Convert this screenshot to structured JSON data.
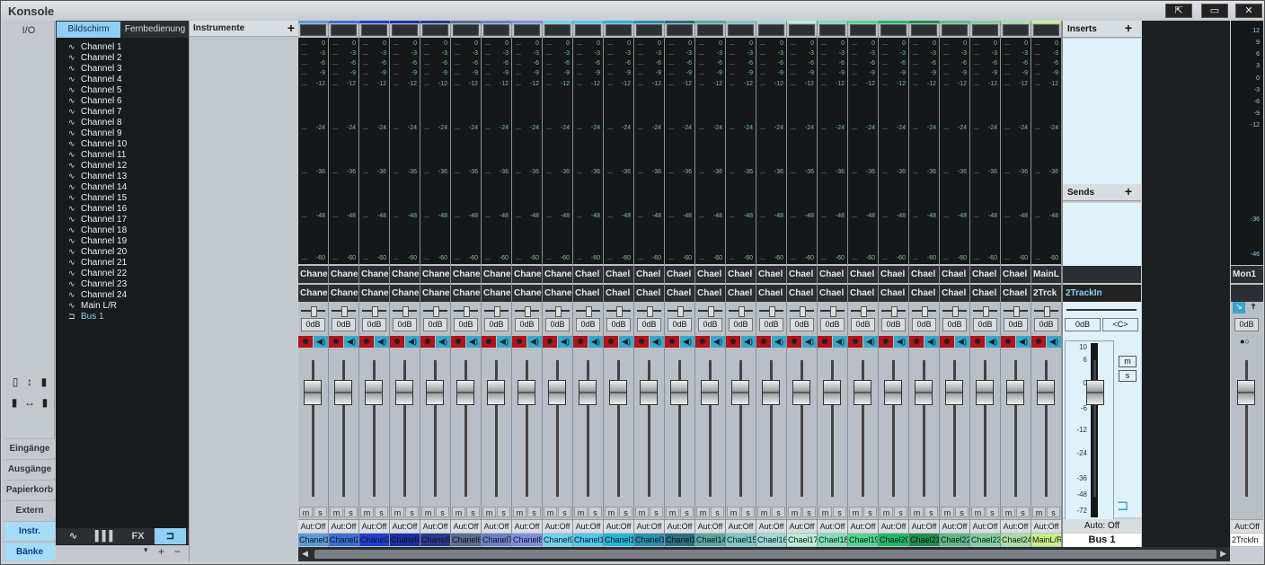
{
  "window": {
    "title": "Konsole"
  },
  "left_nav": {
    "io": "I/O",
    "items": [
      "Eingänge",
      "Ausgänge",
      "Papierkorb",
      "Extern",
      "Instr.",
      "Bänke"
    ]
  },
  "browser": {
    "tab_display": "Bildschirm",
    "tab_remote": "Fernbedienung",
    "items": [
      "Channel 1",
      "Channel 2",
      "Channel 3",
      "Channel 4",
      "Channel 5",
      "Channel 6",
      "Channel 7",
      "Channel 8",
      "Channel 9",
      "Channel 10",
      "Channel 11",
      "Channel 12",
      "Channel 13",
      "Channel 14",
      "Channel 15",
      "Channel 16",
      "Channel 17",
      "Channel 18",
      "Channel 19",
      "Channel 20",
      "Channel 21",
      "Channel 22",
      "Channel 23",
      "Channel 24",
      "Main L/R",
      "Bus 1"
    ],
    "bottom_tabs": [
      "FX"
    ],
    "footer": {
      "add": "+",
      "remove": "−"
    }
  },
  "instruments": {
    "title": "Instrumente",
    "add": "+"
  },
  "meter_scale": [
    "0",
    "-3",
    "-6",
    "-9",
    "-12",
    "-24",
    "-36",
    "-48",
    "-60"
  ],
  "channels": [
    {
      "name1": "Chane",
      "name2": "Chane",
      "label": "Chanel1",
      "color": "#5b9bd5"
    },
    {
      "name1": "Chane",
      "name2": "Chane",
      "label": "Chanel2",
      "color": "#3b6fd6"
    },
    {
      "name1": "Chane",
      "name2": "Chane",
      "label": "Chanel3",
      "color": "#1f3fcf"
    },
    {
      "name1": "Chane",
      "name2": "Chane",
      "label": "Chanel4",
      "color": "#1a2fa6"
    },
    {
      "name1": "Chane",
      "name2": "Chane",
      "label": "Chanel5",
      "color": "#283a8f"
    },
    {
      "name1": "Chane",
      "name2": "Chane",
      "label": "Chanel6",
      "color": "#5a6f8f"
    },
    {
      "name1": "Chane",
      "name2": "Chane",
      "label": "Chanel7",
      "color": "#6a7fc8"
    },
    {
      "name1": "Chane",
      "name2": "Chane",
      "label": "Chanel8",
      "color": "#7f8fe0"
    },
    {
      "name1": "Chane",
      "name2": "Chane",
      "label": "Chanel9",
      "color": "#6fd3f0"
    },
    {
      "name1": "Chael",
      "name2": "Chael",
      "label": "Chanel10",
      "color": "#4fc8ec"
    },
    {
      "name1": "Chael",
      "name2": "Chael",
      "label": "Chanel11",
      "color": "#24b6d8"
    },
    {
      "name1": "Chael",
      "name2": "Chael",
      "label": "Chanel12",
      "color": "#2a8fb0"
    },
    {
      "name1": "Chael",
      "name2": "Chael",
      "label": "Chanel13",
      "color": "#2a6f80"
    },
    {
      "name1": "Chael",
      "name2": "Chael",
      "label": "Chael14",
      "color": "#5aa8a0"
    },
    {
      "name1": "Chael",
      "name2": "Chael",
      "label": "Chael15",
      "color": "#7cc6c8"
    },
    {
      "name1": "Chael",
      "name2": "Chael",
      "label": "Chael16",
      "color": "#9fd9d4"
    },
    {
      "name1": "Chael",
      "name2": "Chael",
      "label": "Chael17",
      "color": "#b7efd8"
    },
    {
      "name1": "Chael",
      "name2": "Chael",
      "label": "Chael18",
      "color": "#7fe0b5"
    },
    {
      "name1": "Chael",
      "name2": "Chael",
      "label": "Chael19",
      "color": "#4fd68f"
    },
    {
      "name1": "Chael",
      "name2": "Chael",
      "label": "Chael20",
      "color": "#21b865"
    },
    {
      "name1": "Chael",
      "name2": "Chael",
      "label": "Chael21",
      "color": "#1f8f4f"
    },
    {
      "name1": "Chael",
      "name2": "Chael",
      "label": "Chael22",
      "color": "#5fb888"
    },
    {
      "name1": "Chael",
      "name2": "Chael",
      "label": "Chael23",
      "color": "#7fcf9f"
    },
    {
      "name1": "Chael",
      "name2": "Chael",
      "label": "Chael24",
      "color": "#a8dfa0"
    },
    {
      "name1": "MainL",
      "name2": "2Trck",
      "label": "MainL/R",
      "color": "#c8f08a"
    }
  ],
  "strip": {
    "db": "0dB",
    "mute": "m",
    "solo": "s",
    "auto": "Aut:Off",
    "monitor": "◀)"
  },
  "bus": {
    "inserts": "Inserts",
    "sends": "Sends",
    "name": "2TrackIn",
    "db": "0dB",
    "pan": "<C>",
    "mute": "m",
    "solo": "s",
    "auto": "Auto: Off",
    "label": "Bus 1",
    "scale": [
      "10",
      "6",
      "0",
      "-6",
      "-12",
      "-24",
      "-36",
      "-48",
      "-72"
    ]
  },
  "monitor": {
    "name": "Mon1",
    "db": "0dB",
    "auto": "Aut:Off",
    "label": "2TrckIn",
    "scale": [
      "12",
      "9",
      "6",
      "3",
      "0",
      "-3",
      "-6",
      "-9",
      "-12",
      "-36",
      "-46"
    ]
  }
}
